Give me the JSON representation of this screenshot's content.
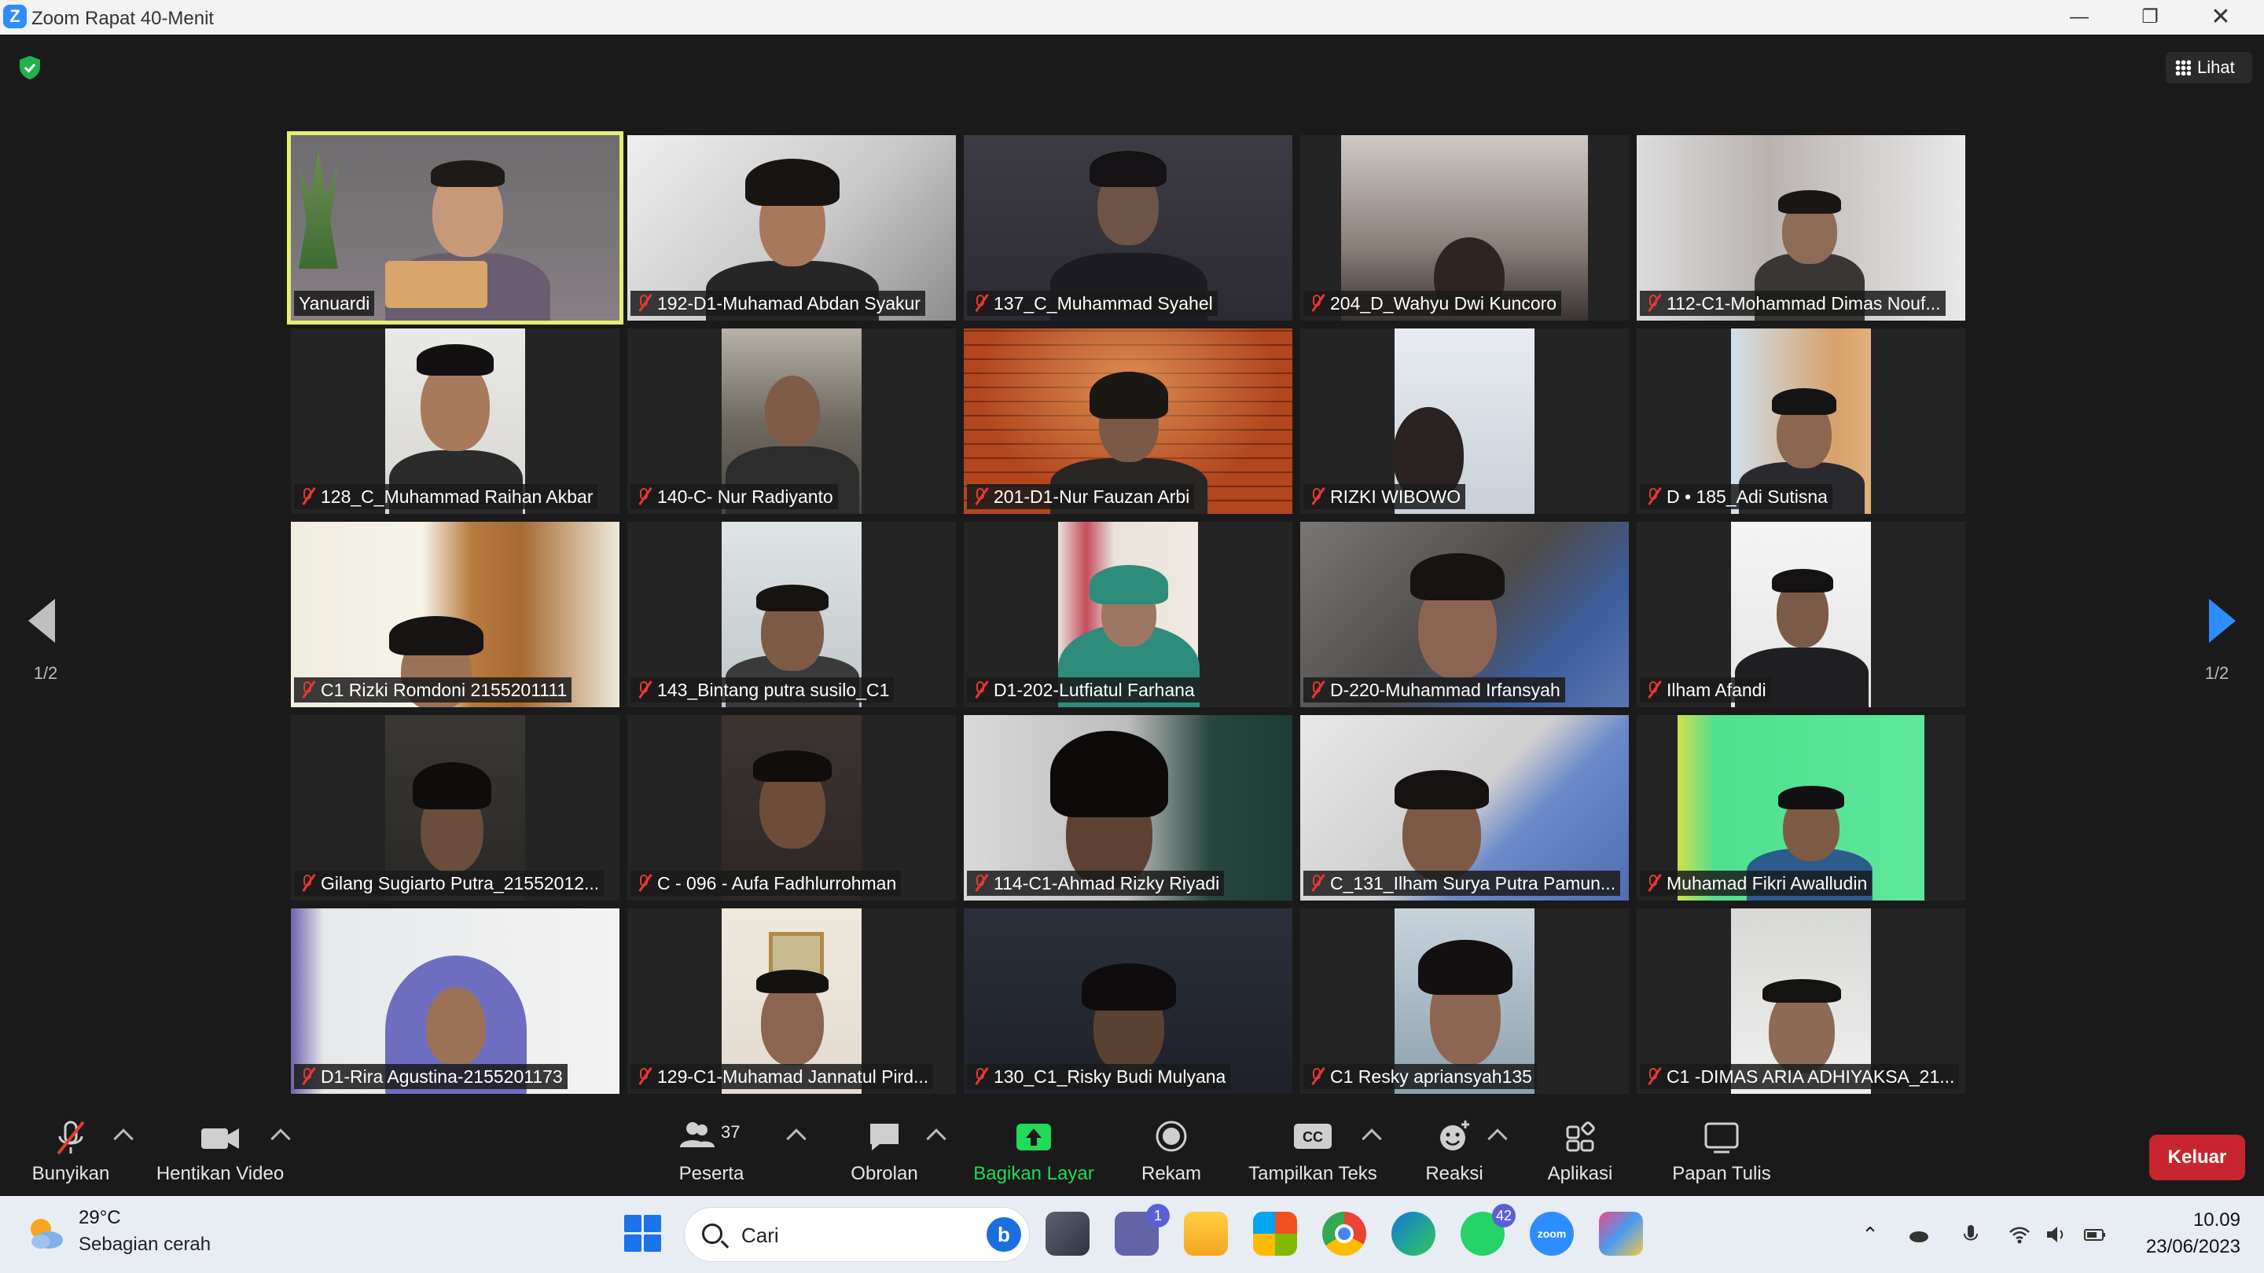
{
  "window": {
    "title": "Zoom Rapat 40-Menit"
  },
  "view_button": {
    "label": "Lihat"
  },
  "pagination": {
    "left": "1/2",
    "right": "1/2"
  },
  "participants": [
    {
      "name": "Yanuardi",
      "muted": false,
      "active": true
    },
    {
      "name": "192-D1-Muhamad Abdan Syakur",
      "muted": true
    },
    {
      "name": "137_C_Muhammad Syahel",
      "muted": true
    },
    {
      "name": "204_D_Wahyu Dwi Kuncoro",
      "muted": true
    },
    {
      "name": "112-C1-Mohammad Dimas Nouf...",
      "muted": true
    },
    {
      "name": "128_C_Muhammad Raihan Akbar",
      "muted": true
    },
    {
      "name": "140-C- Nur Radiyanto",
      "muted": true
    },
    {
      "name": "201-D1-Nur Fauzan Arbi",
      "muted": true
    },
    {
      "name": "RIZKI WIBOWO",
      "muted": true
    },
    {
      "name": "D • 185_Adi Sutisna",
      "muted": true
    },
    {
      "name": "C1 Rizki Romdoni 2155201111",
      "muted": true
    },
    {
      "name": "143_Bintang putra susilo_C1",
      "muted": true
    },
    {
      "name": "D1-202-Lutfiatul Farhana",
      "muted": true
    },
    {
      "name": "D-220-Muhammad Irfansyah",
      "muted": true
    },
    {
      "name": "Ilham Afandi",
      "muted": true
    },
    {
      "name": "Gilang Sugiarto Putra_21552012...",
      "muted": true
    },
    {
      "name": "C - 096 - Aufa Fadhlurrohman",
      "muted": true
    },
    {
      "name": "114-C1-Ahmad Rizky Riyadi",
      "muted": true
    },
    {
      "name": "C_131_Ilham Surya Putra Pamun...",
      "muted": true
    },
    {
      "name": "Muhamad Fikri Awalludin",
      "muted": true
    },
    {
      "name": "D1-Rira Agustina-2155201173",
      "muted": true
    },
    {
      "name": "129-C1-Muhamad Jannatul Pird...",
      "muted": true
    },
    {
      "name": "130_C1_Risky Budi Mulyana",
      "muted": true
    },
    {
      "name": "C1 Resky apriansyah135",
      "muted": true
    },
    {
      "name": "C1 -DIMAS ARIA ADHIYAKSA_21...",
      "muted": true
    }
  ],
  "toolbar": {
    "unmute": "Bunyikan",
    "stop_video": "Hentikan Video",
    "participants": "Peserta",
    "participants_count": "37",
    "chat": "Obrolan",
    "share_screen": "Bagikan Layar",
    "record": "Rekam",
    "captions": "Tampilkan Teks",
    "captions_icon_text": "CC",
    "reactions": "Reaksi",
    "apps": "Aplikasi",
    "whiteboard": "Papan Tulis",
    "leave": "Keluar"
  },
  "taskbar": {
    "weather_temp": "29°C",
    "weather_desc": "Sebagian cerah",
    "search_placeholder": "Cari",
    "teams_badge": "1",
    "whatsapp_badge": "42",
    "zoom_label": "zoom",
    "time": "10.09",
    "date": "23/06/2023"
  },
  "colors": {
    "accent": "#2d8cff",
    "active_speaker": "#e6ef72",
    "leave": "#c8262f",
    "share": "#23d959",
    "muted_icon": "#e53935"
  }
}
